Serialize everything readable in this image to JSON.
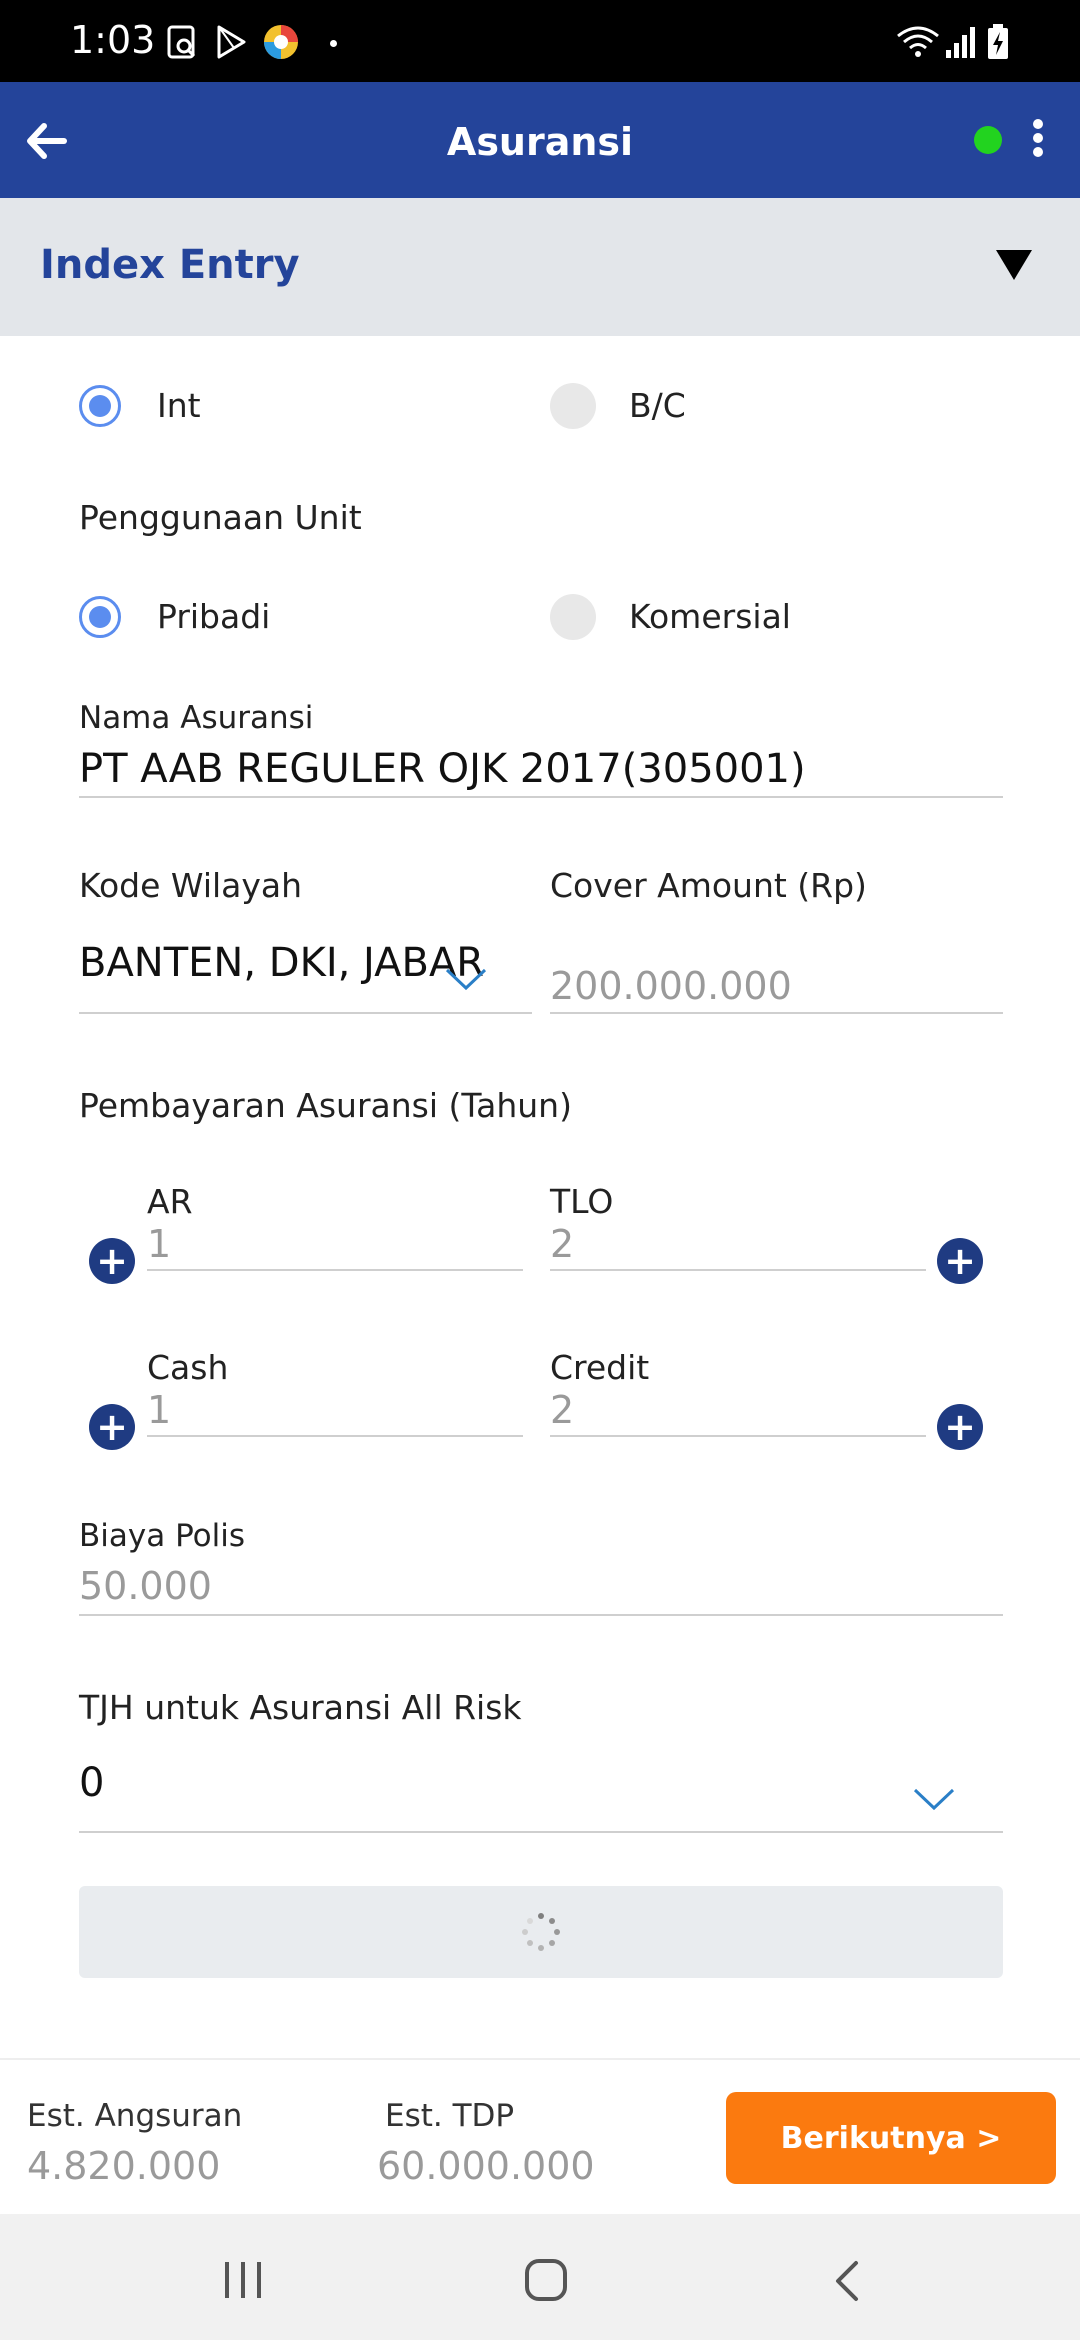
{
  "status_bar": {
    "time": "1:03"
  },
  "app_bar": {
    "title": "Asuransi"
  },
  "section": {
    "label": "Index Entry"
  },
  "type_options": [
    {
      "label": "Int",
      "selected": true
    },
    {
      "label": "B/C",
      "selected": false
    }
  ],
  "penggunaan_unit": {
    "label": "Penggunaan Unit",
    "options": [
      {
        "label": "Pribadi",
        "selected": true
      },
      {
        "label": "Komersial",
        "selected": false
      }
    ]
  },
  "nama_asuransi": {
    "label": "Nama Asuransi",
    "value": "PT AAB REGULER OJK 2017(305001)"
  },
  "kode_wilayah": {
    "label": "Kode Wilayah",
    "value": "BANTEN, DKI, JABAR"
  },
  "cover_amount": {
    "label": "Cover Amount (Rp)",
    "value": "200.000.000"
  },
  "pembayaran": {
    "label": "Pembayaran Asuransi (Tahun)",
    "ar": {
      "label": "AR",
      "value": "1"
    },
    "tlo": {
      "label": "TLO",
      "value": "2"
    },
    "cash": {
      "label": "Cash",
      "value": "1"
    },
    "credit": {
      "label": "Credit",
      "value": "2"
    }
  },
  "biaya_polis": {
    "label": "Biaya Polis",
    "value": "50.000"
  },
  "tjh": {
    "label": "TJH untuk Asuransi All Risk",
    "value": "0"
  },
  "footer": {
    "angsuran_label": "Est. Angsuran",
    "angsuran_value": "4.820.000",
    "tdp_label": "Est. TDP",
    "tdp_value": "60.000.000",
    "next_label": "Berikutnya >"
  },
  "colors": {
    "primary": "#24449a",
    "accent": "#fb7a0f",
    "radio": "#5b8def",
    "online": "#22d31f"
  }
}
